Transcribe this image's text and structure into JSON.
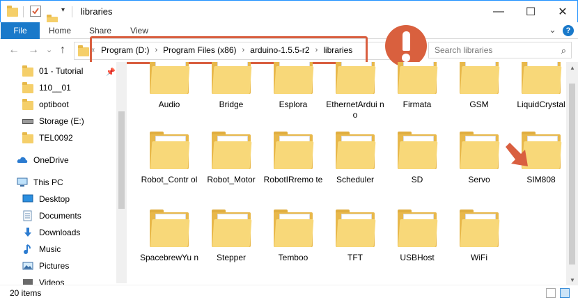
{
  "window": {
    "title": "libraries",
    "minimize": "—",
    "maximize": "☐",
    "close": "✕"
  },
  "ribbon": {
    "tabs": [
      "File",
      "Home",
      "Share",
      "View"
    ],
    "expand": "⌄",
    "help": "?"
  },
  "nav": {
    "back": "←",
    "forward": "→",
    "recent": "⌄",
    "up": "↑",
    "breadcrumb_lead": "«",
    "breadcrumb": [
      "Program (D:)",
      "Program Files (x86)",
      "arduino-1.5.5-r2",
      "libraries"
    ],
    "breadcrumb_sep": "›",
    "search_placeholder": "Search libraries"
  },
  "sidebar": {
    "items": [
      {
        "label": "01 - Tutorial",
        "icon": "folder-icon"
      },
      {
        "label": "110__01",
        "icon": "folder-icon"
      },
      {
        "label": "optiboot",
        "icon": "folder-icon"
      },
      {
        "label": "Storage (E:)",
        "icon": "drive-icon"
      },
      {
        "label": "TEL0092",
        "icon": "folder-icon"
      },
      {
        "label": "OneDrive",
        "icon": "cloud-icon"
      },
      {
        "label": "This PC",
        "icon": "computer-icon"
      },
      {
        "label": "Desktop",
        "icon": "desktop-icon"
      },
      {
        "label": "Documents",
        "icon": "documents-icon"
      },
      {
        "label": "Downloads",
        "icon": "download-icon"
      },
      {
        "label": "Music",
        "icon": "music-icon"
      },
      {
        "label": "Pictures",
        "icon": "pictures-icon"
      },
      {
        "label": "Videos",
        "icon": "video-icon"
      }
    ]
  },
  "folders": [
    [
      "Audio",
      "Bridge",
      "Esplora",
      "EthernetArdui no",
      "Firmata",
      "GSM",
      "LiquidCrystal"
    ],
    [
      "Robot_Contr ol",
      "Robot_Motor",
      "RobotIRremo te",
      "Scheduler",
      "SD",
      "Servo",
      "SIM808"
    ],
    [
      "SpacebrewYu n",
      "Stepper",
      "Temboo",
      "TFT",
      "USBHost",
      "WiFi"
    ]
  ],
  "status": {
    "items_count": "20 items"
  },
  "colors": {
    "accent": "#1979ca",
    "highlight": "#d95f40",
    "folder": "#f8d879"
  }
}
